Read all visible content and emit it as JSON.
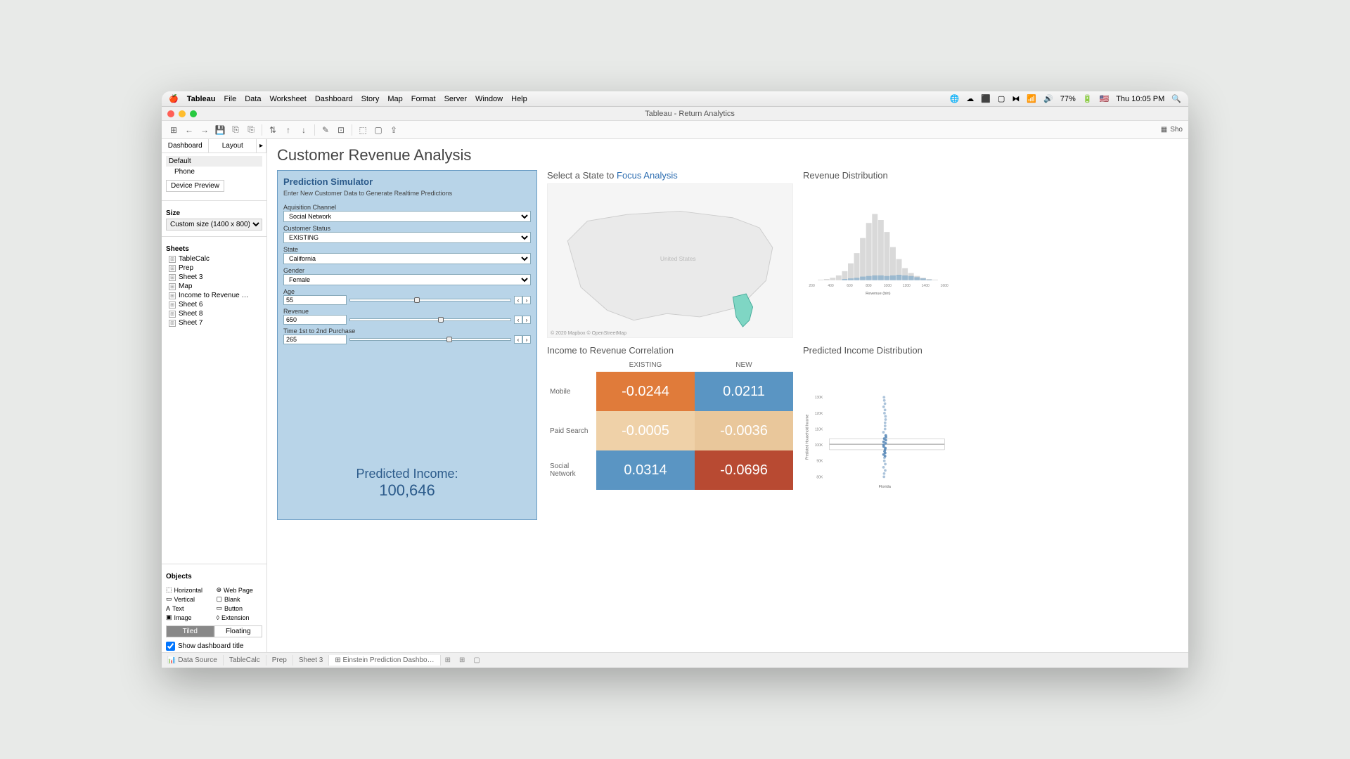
{
  "menubar": {
    "app": "Tableau",
    "items": [
      "File",
      "Data",
      "Worksheet",
      "Dashboard",
      "Story",
      "Map",
      "Format",
      "Server",
      "Window",
      "Help"
    ],
    "battery": "77%",
    "clock": "Thu 10:05 PM"
  },
  "window": {
    "title": "Tableau - Return Analytics"
  },
  "toolbar": {
    "showme": "Sho"
  },
  "sidebar": {
    "tabs": [
      "Dashboard",
      "Layout"
    ],
    "default": "Default",
    "phone": "Phone",
    "device_preview": "Device Preview",
    "size_hdr": "Size",
    "size_value": "Custom size (1400 x 800)",
    "sheets_hdr": "Sheets",
    "sheets": [
      "TableCalc",
      "Prep",
      "Sheet 3",
      "Map",
      "Income to Revenue …",
      "Sheet 6",
      "Sheet 8",
      "Sheet 7"
    ],
    "objects_hdr": "Objects",
    "objects": [
      {
        "icon": "⬚",
        "label": "Horizontal"
      },
      {
        "icon": "⊕",
        "label": "Web Page"
      },
      {
        "icon": "▭",
        "label": "Vertical"
      },
      {
        "icon": "▢",
        "label": "Blank"
      },
      {
        "icon": "A",
        "label": "Text"
      },
      {
        "icon": "▭",
        "label": "Button"
      },
      {
        "icon": "▣",
        "label": "Image"
      },
      {
        "icon": "◊",
        "label": "Extension"
      }
    ],
    "tiled": "Tiled",
    "floating": "Floating",
    "show_title": "Show dashboard title"
  },
  "dashboard": {
    "title": "Customer Revenue Analysis",
    "map_title_a": "Select a State to ",
    "map_title_b": "Focus Analysis",
    "map_label": "United States",
    "map_foot": "© 2020 Mapbox © OpenStreetMap",
    "hist_title": "Revenue Distribution",
    "hist_xlabel": "Revenue (bin)",
    "corr_title": "Income to Revenue Correlation",
    "scatter_title": "Predicted Income Distribution",
    "scatter_ylabel": "Predicted Household Income",
    "scatter_xlabel": "Florida"
  },
  "simulator": {
    "title": "Prediction Simulator",
    "subtitle": "Enter New Customer Data to Generate Realtime Predictions",
    "acq_label": "Aquisition Channel",
    "acq_value": "Social Network",
    "status_label": "Customer Status",
    "status_value": "EXISTING",
    "state_label": "State",
    "state_value": "California",
    "gender_label": "Gender",
    "gender_value": "Female",
    "age_label": "Age",
    "age_value": "55",
    "rev_label": "Revenue",
    "rev_value": "650",
    "time_label": "Time 1st to 2nd Purchase",
    "time_value": "265",
    "result_label": "Predicted Income:",
    "result_value": "100,646"
  },
  "sheetbar": {
    "datasource": "Data Source",
    "tabs": [
      "TableCalc",
      "Prep",
      "Sheet 3",
      "Einstein Prediction Dashbo…"
    ]
  },
  "chart_data": [
    {
      "type": "bar",
      "title": "Revenue Distribution",
      "xlabel": "Revenue (bin)",
      "ylabel": "",
      "x_ticks": [
        200,
        400,
        600,
        800,
        1000,
        1200,
        1400,
        1600
      ],
      "series": [
        {
          "name": "background",
          "color": "#d9d9d9",
          "values": [
            0,
            1,
            2,
            4,
            8,
            15,
            28,
            45,
            70,
            95,
            110,
            100,
            80,
            55,
            35,
            20,
            12,
            7,
            4,
            2,
            1,
            0
          ]
        },
        {
          "name": "highlight",
          "color": "#9bb9cf",
          "values": [
            0,
            0,
            0,
            0,
            0,
            2,
            3,
            4,
            6,
            7,
            8,
            8,
            7,
            8,
            9,
            8,
            7,
            5,
            3,
            1,
            0,
            0
          ]
        }
      ],
      "x_start": 250,
      "x_step": 65
    },
    {
      "type": "heatmap",
      "title": "Income to Revenue Correlation",
      "columns": [
        "EXISTING",
        "NEW"
      ],
      "rows": [
        "Mobile",
        "Paid Search",
        "Social Network"
      ],
      "values": [
        [
          -0.0244,
          0.0211
        ],
        [
          -0.0005,
          -0.0036
        ],
        [
          0.0314,
          -0.0696
        ]
      ],
      "colors": [
        [
          "#e07b3a",
          "#5a95c3"
        ],
        [
          "#efd1a8",
          "#e9c79b"
        ],
        [
          "#5a95c3",
          "#b84a32"
        ]
      ]
    },
    {
      "type": "scatter",
      "title": "Predicted Income Distribution",
      "ylabel": "Predicted Household Income",
      "xlabel": "Florida",
      "y_ticks": [
        "80K",
        "90K",
        "100K",
        "110K",
        "120K",
        "130K"
      ],
      "ylim": [
        80000,
        130000
      ],
      "band": [
        97000,
        104000
      ],
      "points_y": [
        130000,
        128000,
        126000,
        124000,
        122000,
        120000,
        118000,
        116000,
        114000,
        112000,
        110000,
        108000,
        106000,
        105000,
        104000,
        103000,
        102000,
        101000,
        100000,
        99000,
        98000,
        97000,
        96000,
        95000,
        94000,
        93000,
        92000,
        90000,
        88000,
        86000,
        84000,
        82000,
        80000
      ]
    }
  ]
}
